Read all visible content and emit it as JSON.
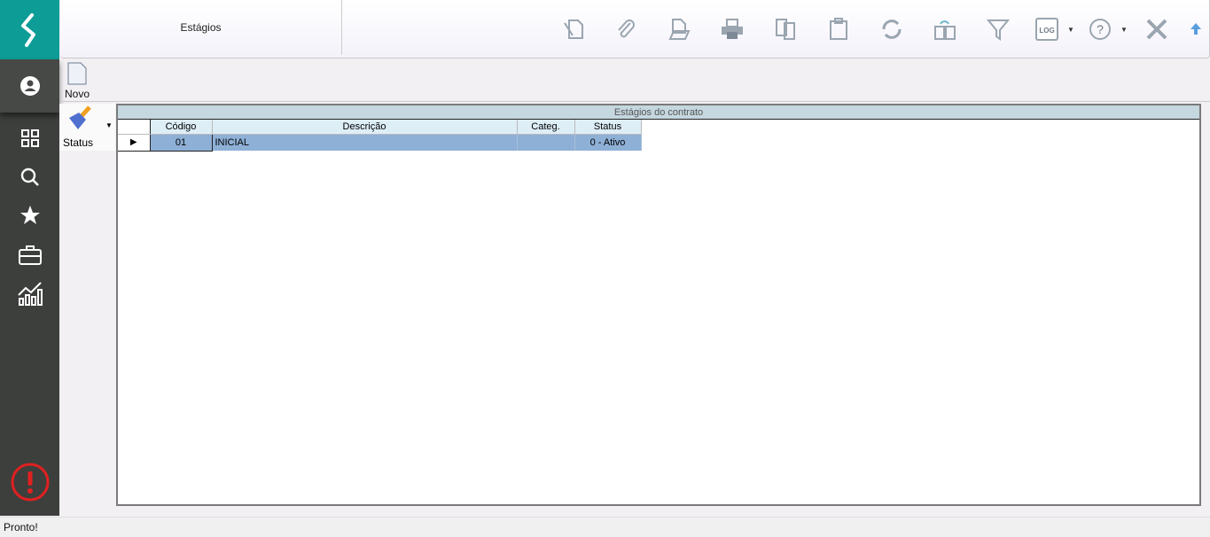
{
  "header": {
    "title": "Estágios"
  },
  "toolbar": {
    "novo_label": "Novo",
    "status_label": "Status",
    "icons": [
      "sign-icon",
      "attach-icon",
      "open-document-icon",
      "print-icon",
      "copy-icon",
      "paste-icon",
      "refresh-icon",
      "duplicate-icon",
      "filter-icon",
      "log-icon",
      "help-icon",
      "close-icon",
      "collapse-up-icon"
    ],
    "log_text": "LOG",
    "help_text": "?"
  },
  "grid": {
    "title": "Estágios do contrato",
    "columns": [
      "Código",
      "Descrição",
      "Categ.",
      "Status"
    ],
    "rows": [
      {
        "codigo": "01",
        "descricao": "INICIAL",
        "categ": "",
        "status": "0 - Ativo"
      }
    ]
  },
  "statusbar": {
    "text": "Pronto!"
  },
  "colors": {
    "brand": "#0e9c96",
    "sidebar": "#3d3f3d",
    "selected_row": "#8eb0d6",
    "alert": "#e02020"
  }
}
